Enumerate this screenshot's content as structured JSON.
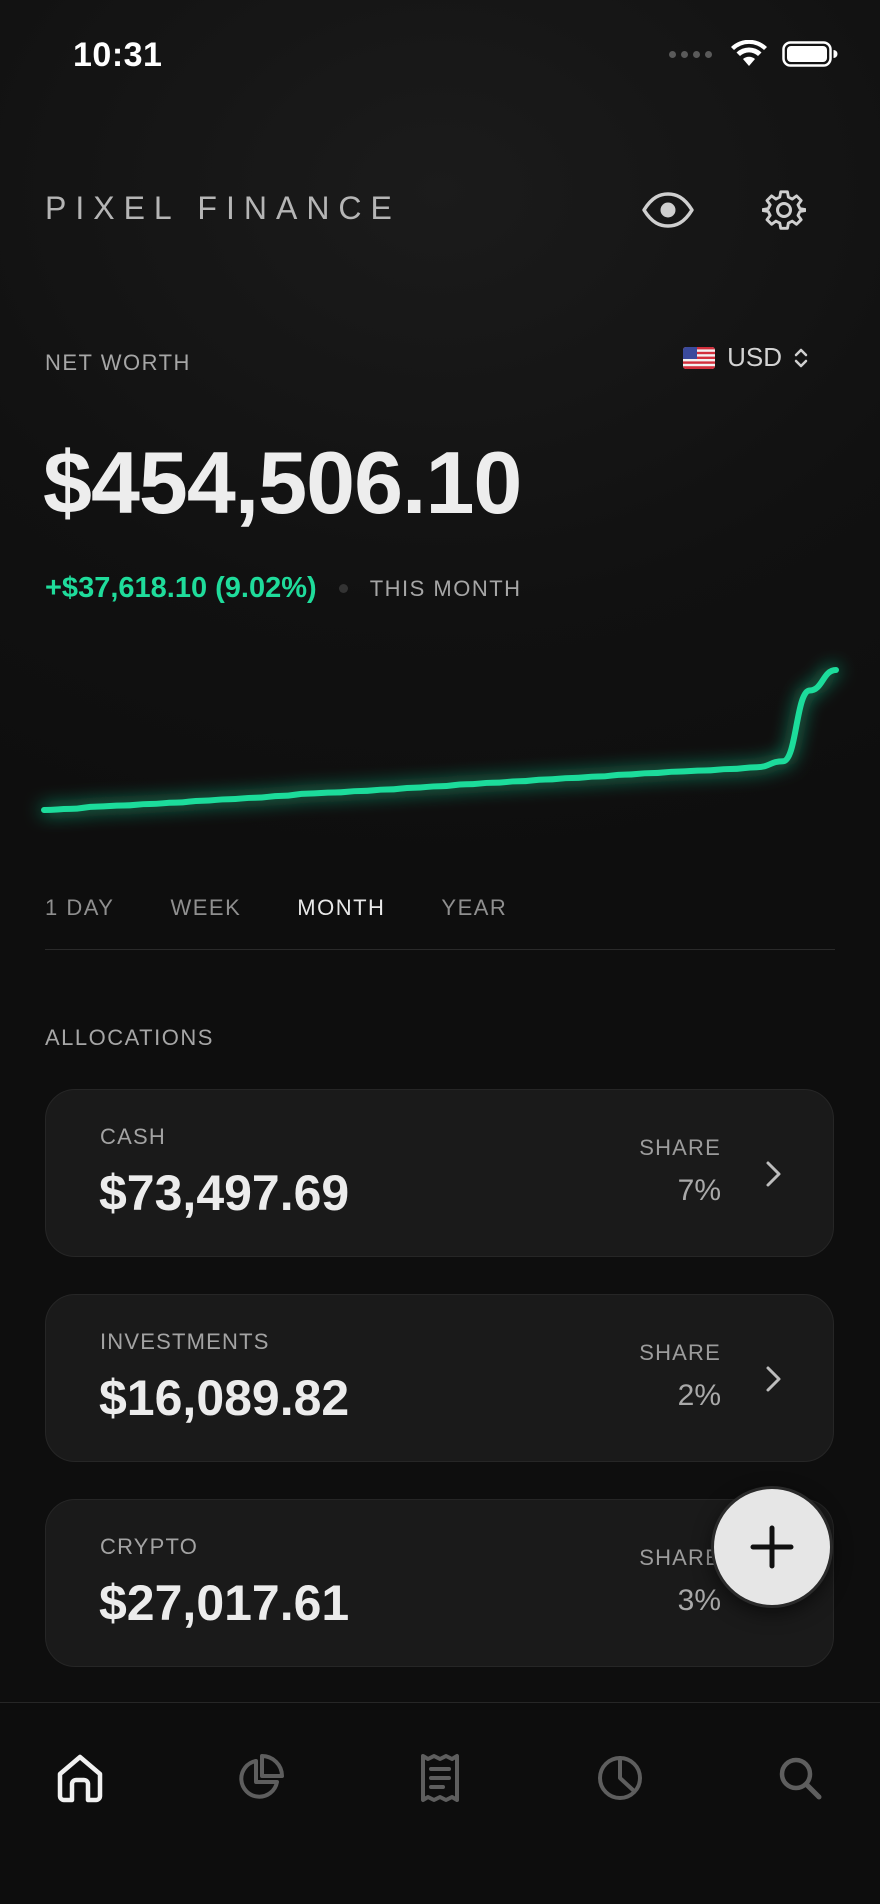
{
  "status_bar": {
    "time": "10:31"
  },
  "header": {
    "app_title": "PIXEL FINANCE"
  },
  "net_worth": {
    "label": "NET WORTH",
    "currency": "USD",
    "value": "$454,506.10",
    "change": "+$37,618.10 (9.02%)",
    "period_label": "THIS MONTH"
  },
  "chart_data": {
    "type": "line",
    "title": "",
    "xlabel": "",
    "ylabel": "",
    "grid": false,
    "legend": "none",
    "x": [
      1,
      2,
      3,
      4,
      5,
      6,
      7,
      8,
      9,
      10,
      11,
      12,
      13,
      14,
      15,
      16,
      17,
      18,
      19,
      20,
      21,
      22,
      23,
      24,
      25,
      26,
      27,
      28,
      29,
      30,
      31
    ],
    "series": [
      {
        "color": "#1fdc9b",
        "values": [
          416.9,
          417.2,
          417.8,
          418.1,
          418.5,
          418.9,
          419.4,
          419.8,
          420.2,
          420.7,
          421.3,
          421.6,
          422.0,
          422.4,
          422.9,
          423.3,
          423.8,
          424.2,
          424.6,
          425.1,
          425.5,
          425.9,
          426.4,
          426.8,
          427.2,
          427.5,
          427.9,
          428.4,
          430.0,
          449.0,
          454.5
        ]
      }
    ],
    "y_unit": "thousand USD"
  },
  "tabs": [
    {
      "label": "1 DAY",
      "active": false
    },
    {
      "label": "WEEK",
      "active": false
    },
    {
      "label": "MONTH",
      "active": true
    },
    {
      "label": "YEAR",
      "active": false
    }
  ],
  "allocations": {
    "title": "ALLOCATIONS",
    "items": [
      {
        "label": "CASH",
        "value": "$73,497.69",
        "share_label": "SHARE",
        "share": "7%"
      },
      {
        "label": "INVESTMENTS",
        "value": "$16,089.82",
        "share_label": "SHARE",
        "share": "2%"
      },
      {
        "label": "CRYPTO",
        "value": "$27,017.61",
        "share_label": "SHARE",
        "share": "3%"
      }
    ]
  },
  "icons": {
    "eye": "eye-icon",
    "settings": "gear-icon",
    "add": "plus-icon",
    "nav": [
      "home-icon",
      "pie-chart-icon",
      "receipt-icon",
      "clock-chart-icon",
      "search-icon"
    ]
  },
  "colors": {
    "accent": "#1fdc9b",
    "background": "#0f0f0f",
    "card": "#1a1a1a"
  }
}
